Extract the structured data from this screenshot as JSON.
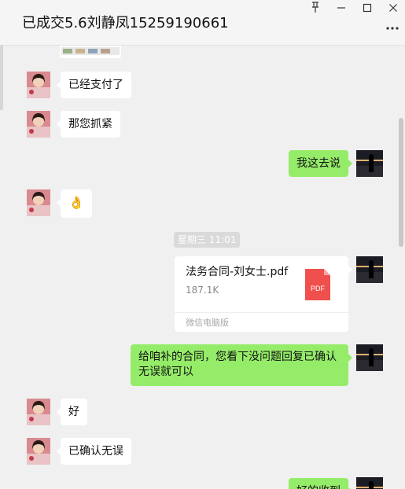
{
  "window": {
    "title": "已成交5.6刘静凤15259190661",
    "pin_icon": "pin-icon",
    "minimize_icon": "minimize-icon",
    "maximize_icon": "maximize-icon",
    "close_icon": "close-icon",
    "more_icon": "more-icon"
  },
  "messages": [
    {
      "side": "in",
      "text": "已经支付了"
    },
    {
      "side": "in",
      "text": "那您抓紧"
    },
    {
      "side": "out",
      "text": "我这去说"
    },
    {
      "side": "in",
      "text": "👌"
    },
    {
      "type": "time",
      "text": "星期三 11:01"
    },
    {
      "side": "out",
      "type": "file",
      "file_name": "法务合同-刘女士.pdf",
      "file_size": "187.1K",
      "file_badge": "PDF",
      "source": "微信电脑版"
    },
    {
      "side": "out",
      "text_line1": "给咱补的合同，您看下没问题回复已确认",
      "text_line2": "无误就可以"
    },
    {
      "side": "in",
      "text": "好"
    },
    {
      "side": "in",
      "text": "已确认无误"
    },
    {
      "side": "out",
      "text": "好的收到"
    }
  ],
  "colors": {
    "outgoing_bubble": "#95ec69",
    "incoming_bubble": "#ffffff",
    "background": "#f0f0f0",
    "pdf_red": "#f0504d"
  }
}
